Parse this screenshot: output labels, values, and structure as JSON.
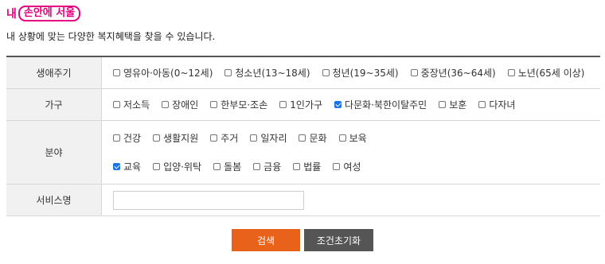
{
  "logo": {
    "prefix": "내",
    "text": "손안에 서울"
  },
  "intro": "내 상황에 맞는 다양한 복지혜택을 찾을 수 있습니다.",
  "rows": {
    "life": {
      "label": "생애주기",
      "options": [
        {
          "label": "영유아·아동(0~12세)",
          "checked": false
        },
        {
          "label": "청소년(13~18세)",
          "checked": false
        },
        {
          "label": "청년(19~35세)",
          "checked": false
        },
        {
          "label": "중장년(36~64세)",
          "checked": false
        },
        {
          "label": "노년(65세 이상)",
          "checked": false
        }
      ]
    },
    "household": {
      "label": "가구",
      "options": [
        {
          "label": "저소득",
          "checked": false
        },
        {
          "label": "장애인",
          "checked": false
        },
        {
          "label": "한부모·조손",
          "checked": false
        },
        {
          "label": "1인가구",
          "checked": false
        },
        {
          "label": "다문화·북한이탈주민",
          "checked": true
        },
        {
          "label": "보훈",
          "checked": false
        },
        {
          "label": "다자녀",
          "checked": false
        }
      ]
    },
    "field": {
      "label": "분야",
      "options_line1": [
        {
          "label": "건강",
          "checked": false
        },
        {
          "label": "생활지원",
          "checked": false
        },
        {
          "label": "주거",
          "checked": false
        },
        {
          "label": "일자리",
          "checked": false
        },
        {
          "label": "문화",
          "checked": false
        },
        {
          "label": "보육",
          "checked": false
        }
      ],
      "options_line2": [
        {
          "label": "교육",
          "checked": true
        },
        {
          "label": "입양·위탁",
          "checked": false
        },
        {
          "label": "돌봄",
          "checked": false
        },
        {
          "label": "금융",
          "checked": false
        },
        {
          "label": "법률",
          "checked": false
        },
        {
          "label": "여성",
          "checked": false
        }
      ]
    },
    "service": {
      "label": "서비스명",
      "value": "",
      "placeholder": ""
    }
  },
  "buttons": {
    "search": "검색",
    "reset": "조건초기화"
  },
  "colors": {
    "brand": "#e4007f",
    "search": "#e8621a",
    "reset": "#555555",
    "check": "#1a73e8"
  }
}
